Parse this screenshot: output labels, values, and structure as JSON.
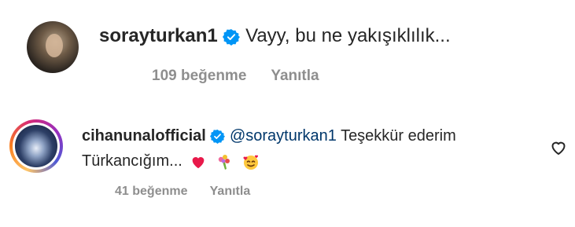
{
  "comments": [
    {
      "username": "sorayturkan1",
      "text": "Vayy, bu ne yakışıklılık...",
      "likes": "109 beğenme",
      "reply_label": "Yanıtla",
      "verified_icon": "verified-badge-icon",
      "accent": "#0095f6"
    },
    {
      "username": "cihanunalofficial",
      "mention": "@sorayturkan1",
      "text_line1": "Teşekkür ederim",
      "text_line2": "Türkancığım...",
      "emojis": [
        "heart",
        "bouquet",
        "smiling-face-with-hearts"
      ],
      "likes": "41 beğenme",
      "reply_label": "Yanıtla",
      "like_icon": "heart-outline-icon"
    }
  ],
  "colors": {
    "text": "#262626",
    "secondary": "#8e8e8e",
    "mention": "#00376b",
    "verified": "#0095f6"
  }
}
